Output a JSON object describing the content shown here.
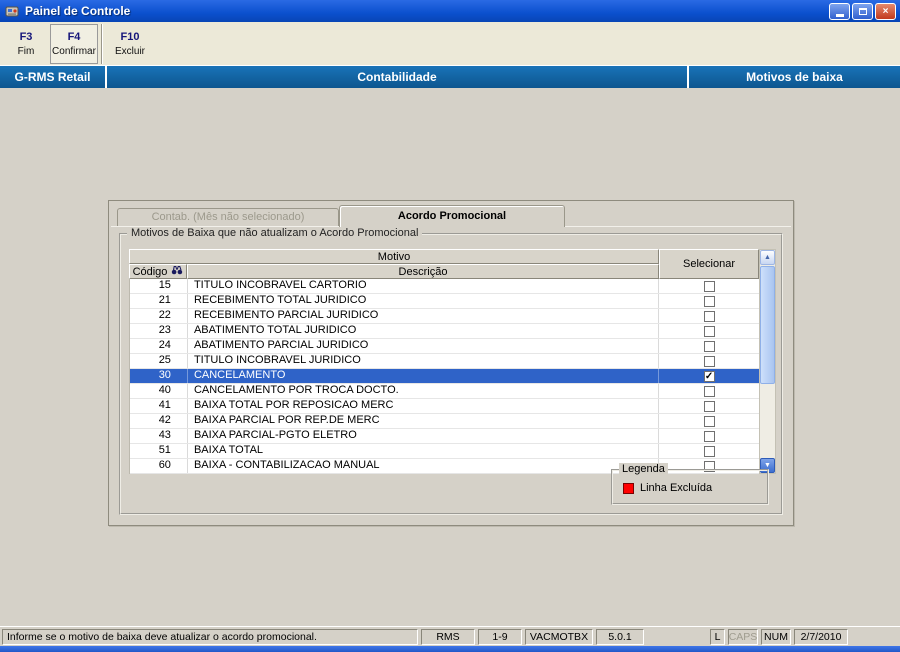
{
  "colors": {
    "titlebar-blue-1": "#2A6AE4",
    "titlebar-blue-2": "#0B50CE",
    "header-blue": "#0F63AC",
    "selection-blue": "#2F63C8",
    "excluded-red": "#FF0000"
  },
  "window": {
    "title": "Painel de Controle"
  },
  "toolbar": {
    "buttons": [
      {
        "key": "F3",
        "label": "Fim"
      },
      {
        "key": "F4",
        "label": "Confirmar"
      },
      {
        "key": "F10",
        "label": "Excluir"
      }
    ]
  },
  "header": {
    "left": "G-RMS Retail",
    "center": "Contabilidade",
    "right": "Motivos de baixa"
  },
  "panel": {
    "tabs": [
      {
        "label": "Contab. (Mês não selecionado)",
        "state": "disabled"
      },
      {
        "label": "Acordo Promocional",
        "state": "active"
      }
    ],
    "groupbox_title": "Motivos de Baixa que  não atualizam o Acordo Promocional",
    "table": {
      "group_header": "Motivo",
      "columns": {
        "code": "Código",
        "description": "Descrição",
        "select": "Selecionar"
      },
      "selected_row_index": 6,
      "rows": [
        {
          "codigo": "15",
          "descricao": "TITULO INCOBRAVEL CARTORIO",
          "checked": false
        },
        {
          "codigo": "21",
          "descricao": "RECEBIMENTO TOTAL JURIDICO",
          "checked": false
        },
        {
          "codigo": "22",
          "descricao": "RECEBIMENTO PARCIAL JURIDICO",
          "checked": false
        },
        {
          "codigo": "23",
          "descricao": "ABATIMENTO TOTAL JURIDICO",
          "checked": false
        },
        {
          "codigo": "24",
          "descricao": "ABATIMENTO PARCIAL JURIDICO",
          "checked": false
        },
        {
          "codigo": "25",
          "descricao": "TITULO INCOBRAVEL JURIDICO",
          "checked": false
        },
        {
          "codigo": "30",
          "descricao": "CANCELAMENTO",
          "checked": true
        },
        {
          "codigo": "40",
          "descricao": "CANCELAMENTO POR TROCA DOCTO.",
          "checked": false
        },
        {
          "codigo": "41",
          "descricao": "BAIXA TOTAL POR REPOSICAO MERC",
          "checked": false
        },
        {
          "codigo": "42",
          "descricao": "BAIXA PARCIAL POR REP.DE MERC",
          "checked": false
        },
        {
          "codigo": "43",
          "descricao": "BAIXA PARCIAL-PGTO ELETRO",
          "checked": false
        },
        {
          "codigo": "51",
          "descricao": "BAIXA TOTAL",
          "checked": false
        },
        {
          "codigo": "60",
          "descricao": "BAIXA - CONTABILIZACAO MANUAL",
          "checked": false
        }
      ]
    },
    "legend": {
      "title": "Legenda",
      "items": [
        {
          "color": "#FF0000",
          "label": "Linha Excluída"
        }
      ]
    }
  },
  "statusbar": {
    "message": "Informe se o motivo de baixa deve atualizar o acordo promocional.",
    "system": "RMS",
    "range": "1-9",
    "program": "VACMOTBX",
    "version": "5.0.1",
    "lock_l": "L",
    "caps": "CAPS",
    "num": "NUM",
    "date": "2/7/2010"
  }
}
